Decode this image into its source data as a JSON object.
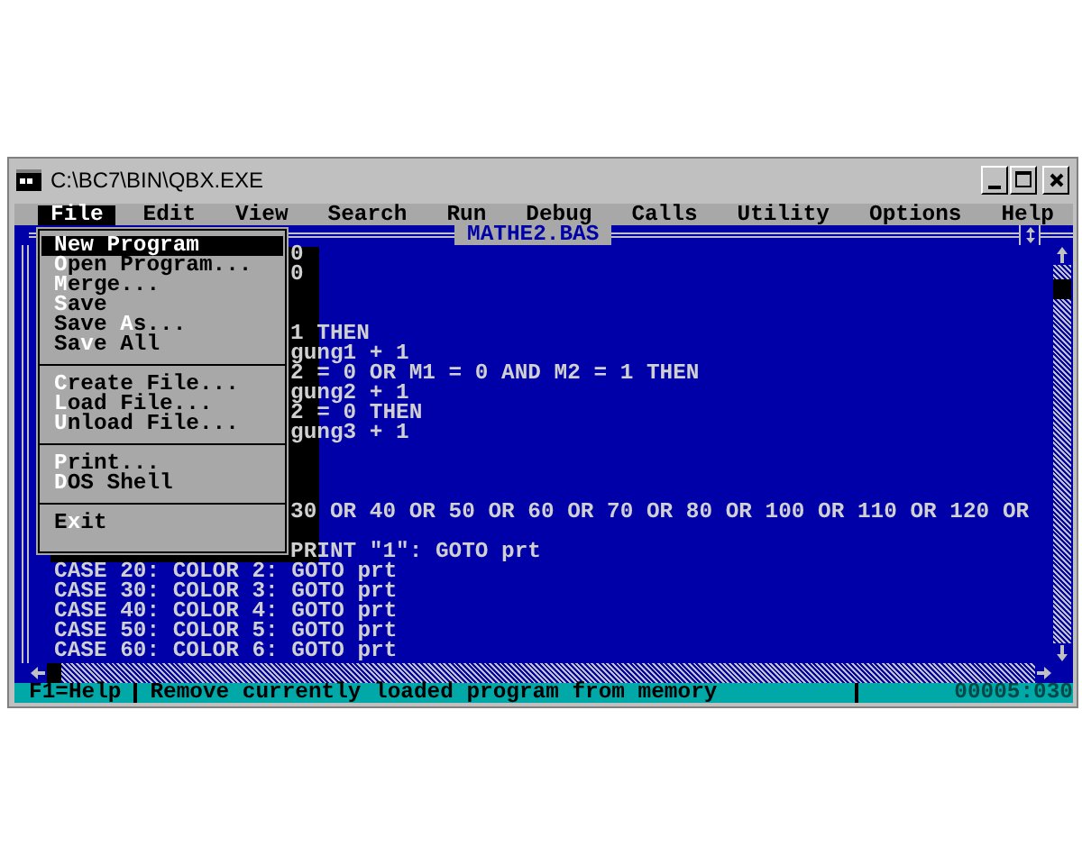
{
  "window": {
    "title": "C:\\BC7\\BIN\\QBX.EXE"
  },
  "menus": [
    {
      "label": "File",
      "selected": true
    },
    {
      "label": "Edit",
      "selected": false
    },
    {
      "label": "View",
      "selected": false
    },
    {
      "label": "Search",
      "selected": false
    },
    {
      "label": "Run",
      "selected": false
    },
    {
      "label": "Debug",
      "selected": false
    },
    {
      "label": "Calls",
      "selected": false
    },
    {
      "label": "Utility",
      "selected": false
    },
    {
      "label": "Options",
      "selected": false
    },
    {
      "label": "Help",
      "selected": false
    }
  ],
  "file_menu": [
    {
      "kind": "item",
      "hotkey": "N",
      "after": "ew Program",
      "selected": true
    },
    {
      "kind": "item",
      "hotkey": "O",
      "after": "pen Program...",
      "selected": false
    },
    {
      "kind": "item",
      "hotkey": "M",
      "after": "erge...",
      "selected": false
    },
    {
      "kind": "item",
      "hotkey": "S",
      "after": "ave",
      "selected": false
    },
    {
      "kind": "item",
      "before": "Save ",
      "hotkey": "A",
      "after": "s...",
      "selected": false
    },
    {
      "kind": "item",
      "before": "Sa",
      "hotkey": "v",
      "after": "e All",
      "selected": false
    },
    {
      "kind": "separator"
    },
    {
      "kind": "item",
      "hotkey": "C",
      "after": "reate File...",
      "selected": false
    },
    {
      "kind": "item",
      "hotkey": "L",
      "after": "oad File...",
      "selected": false
    },
    {
      "kind": "item",
      "hotkey": "U",
      "after": "nload File...",
      "selected": false
    },
    {
      "kind": "separator"
    },
    {
      "kind": "item",
      "hotkey": "P",
      "after": "rint...",
      "selected": false
    },
    {
      "kind": "item",
      "hotkey": "D",
      "after": "OS Shell",
      "selected": false
    },
    {
      "kind": "separator"
    },
    {
      "kind": "item",
      "before": "E",
      "hotkey": "x",
      "after": "it",
      "selected": false
    }
  ],
  "editor": {
    "title": "MATHE2.BAS",
    "lines": [
      {
        "kind": "code",
        "text": "0"
      },
      {
        "kind": "code",
        "text": "0"
      },
      {
        "kind": "blank"
      },
      {
        "kind": "blank"
      },
      {
        "kind": "code",
        "text": "1 THEN"
      },
      {
        "kind": "code",
        "text": "gung1 + 1"
      },
      {
        "kind": "code",
        "text": "2 = 0 OR M1 = 0 AND M2 = 1 THEN"
      },
      {
        "kind": "code",
        "text": "gung2 + 1"
      },
      {
        "kind": "code",
        "text": "2 = 0 THEN"
      },
      {
        "kind": "code",
        "text": "gung3 + 1"
      },
      {
        "kind": "blank"
      },
      {
        "kind": "blank"
      },
      {
        "kind": "blank"
      },
      {
        "kind": "code",
        "text": "30 OR 40 OR 50 OR 60 OR 70 OR 80 OR 100 OR 110 OR 120 OR"
      },
      {
        "kind": "blank"
      },
      {
        "kind": "code",
        "text": "PRINT \"1\": GOTO prt"
      },
      {
        "kind": "code",
        "text": "CASE 20: COLOR 2: GOTO prt"
      },
      {
        "kind": "code",
        "text": "CASE 30: COLOR 3: GOTO prt"
      },
      {
        "kind": "code",
        "text": "CASE 40: COLOR 4: GOTO prt"
      },
      {
        "kind": "code",
        "text": "CASE 50: COLOR 5: GOTO prt"
      },
      {
        "kind": "code",
        "text": "CASE 60: COLOR 6: GOTO prt"
      }
    ]
  },
  "status_bar": {
    "help": "F1=Help",
    "message": "Remove currently loaded program from memory",
    "position": "00005:030"
  }
}
